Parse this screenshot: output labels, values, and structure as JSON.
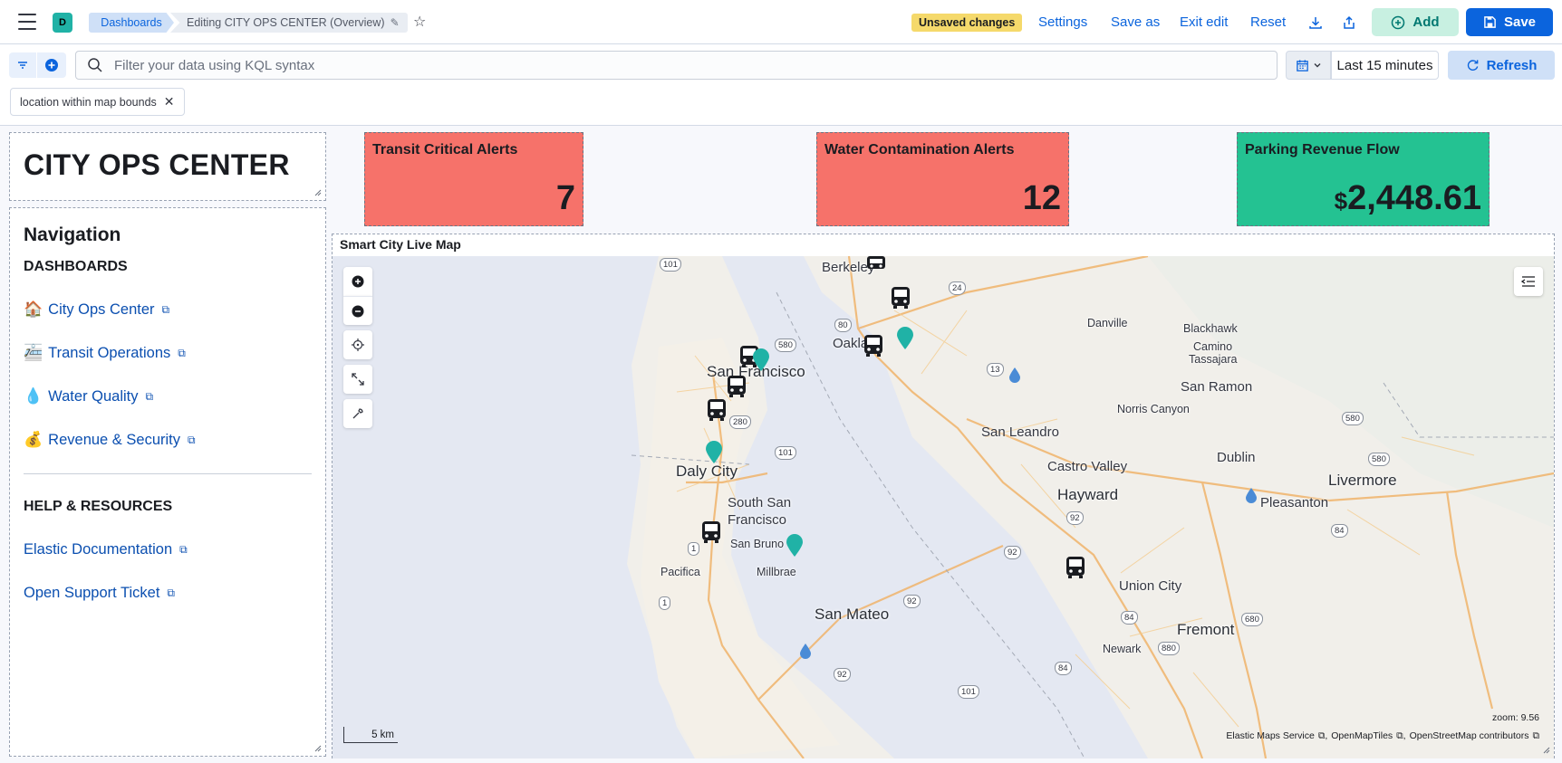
{
  "header": {
    "space_initial": "D",
    "breadcrumb_root": "Dashboards",
    "breadcrumb_current": "Editing CITY OPS CENTER (Overview)",
    "unsaved_badge": "Unsaved changes",
    "settings_label": "Settings",
    "save_as_label": "Save as",
    "exit_edit_label": "Exit edit",
    "reset_label": "Reset",
    "add_label": "Add",
    "save_label": "Save"
  },
  "query": {
    "placeholder": "Filter your data using KQL syntax",
    "time_range": "Last 15 minutes",
    "refresh_label": "Refresh",
    "filter_pill": "location within map bounds"
  },
  "title_panel": {
    "title": "CITY OPS CENTER"
  },
  "navigation": {
    "heading": "Navigation",
    "dashboards_heading": "DASHBOARDS",
    "links": [
      {
        "emoji": "🏠",
        "label": "City Ops Center"
      },
      {
        "emoji": "🚈",
        "label": "Transit Operations"
      },
      {
        "emoji": "💧",
        "label": "Water Quality"
      },
      {
        "emoji": "💰",
        "label": "Revenue & Security"
      }
    ],
    "help_heading": "HELP & RESOURCES",
    "help_links": [
      {
        "label": "Elastic Documentation"
      },
      {
        "label": "Open Support Ticket"
      }
    ]
  },
  "metrics": [
    {
      "label": "Transit Critical Alerts",
      "value": "7",
      "color": "#f6726a"
    },
    {
      "label": "Water Contamination Alerts",
      "value": "12",
      "color": "#f6726a"
    },
    {
      "label": "Parking Revenue Flow",
      "currency": "$",
      "value": "2,448.61",
      "color": "#24c292"
    }
  ],
  "map": {
    "title": "Smart City Live Map",
    "scale": "5 km",
    "zoom_label": "zoom:",
    "zoom_value": "9.56",
    "attribution": [
      "Elastic Maps Service",
      "OpenMapTiles",
      "OpenStreetMap contributors"
    ],
    "places": {
      "berkeley": "Berkeley",
      "oakland": "Oakland",
      "san_francisco": "San Francisco",
      "danville": "Danville",
      "blackhawk": "Blackhawk",
      "camino": "Camino",
      "tassajara": "Tassajara",
      "san_ramon": "San Ramon",
      "norris_canyon": "Norris Canyon",
      "san_leandro": "San Leandro",
      "castro_valley": "Castro Valley",
      "dublin": "Dublin",
      "livermore": "Livermore",
      "pleasanton": "Pleasanton",
      "hayward": "Hayward",
      "daly_city": "Daly City",
      "south_sf_1": "South San",
      "south_sf_2": "Francisco",
      "san_bruno": "San Bruno",
      "millbrae": "Millbrae",
      "pacifica": "Pacifica",
      "san_mateo": "San Mateo",
      "union_city": "Union City",
      "fremont": "Fremont",
      "newark": "Newark"
    },
    "shields": [
      "101",
      "24",
      "80",
      "13",
      "580",
      "580",
      "101",
      "280",
      "92",
      "92",
      "84",
      "1",
      "1",
      "92",
      "84",
      "680",
      "880",
      "84",
      "92",
      "101",
      "580"
    ],
    "colors": {
      "water": "#e6eaf4",
      "land": "#f3f1ec",
      "transit_marker": "#1a1c21",
      "alert_marker": "#20b2a6",
      "water_drop": "#4a8bd6"
    }
  }
}
